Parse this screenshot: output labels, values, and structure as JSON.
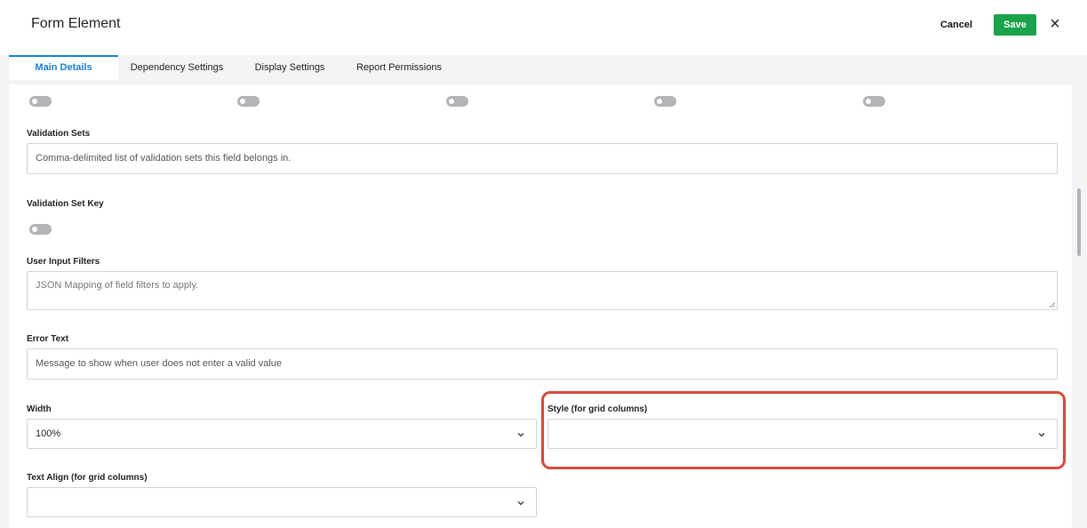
{
  "header": {
    "title": "Form Element",
    "cancel_label": "Cancel",
    "save_label": "Save",
    "close_glyph": "×"
  },
  "tabs": [
    {
      "label": "Main Details",
      "active": true
    },
    {
      "label": "Dependency Settings",
      "active": false
    },
    {
      "label": "Display Settings",
      "active": false
    },
    {
      "label": "Report Permissions",
      "active": false
    }
  ],
  "toggles_row": [
    {
      "state": "off"
    },
    {
      "state": "off"
    },
    {
      "state": "off"
    },
    {
      "state": "off"
    },
    {
      "state": "off"
    }
  ],
  "fields": {
    "validation_sets": {
      "label": "Validation Sets",
      "value": "Comma-delimited list of validation sets this field belongs in."
    },
    "validation_set_key": {
      "label": "Validation Set Key",
      "toggle_state": "off"
    },
    "user_input_filters": {
      "label": "User Input Filters",
      "placeholder": "JSON Mapping of field filters to apply."
    },
    "error_text": {
      "label": "Error Text",
      "value": "Message to show when user does not enter a valid value"
    },
    "width": {
      "label": "Width",
      "selected": "100%"
    },
    "style": {
      "label": "Style (for grid columns)",
      "selected": ""
    },
    "text_align": {
      "label": "Text Align (for grid columns)",
      "selected": ""
    }
  },
  "colors": {
    "accent": "#1a7fd4",
    "save": "#1aa34a",
    "highlight": "#d24c3b",
    "toggle_off": "#b3b3b7"
  },
  "icons": [
    "close-icon",
    "chevron-down-icon",
    "resize-grip-icon"
  ]
}
